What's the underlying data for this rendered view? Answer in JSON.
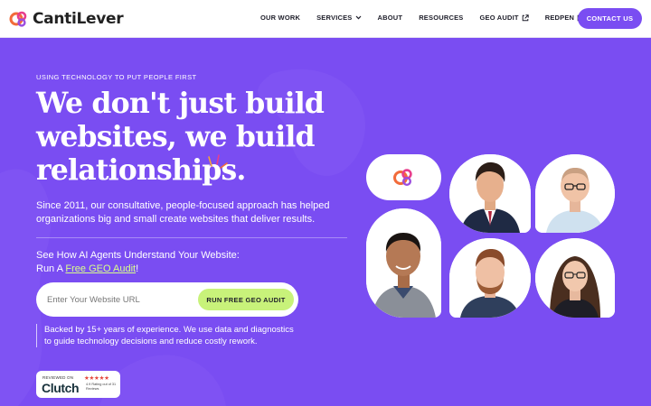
{
  "header": {
    "brand": "CantiLever",
    "nav": [
      {
        "label": "OUR WORK",
        "icon": null
      },
      {
        "label": "SERVICES",
        "icon": "chevron-down-icon"
      },
      {
        "label": "ABOUT",
        "icon": null
      },
      {
        "label": "RESOURCES",
        "icon": null
      },
      {
        "label": "GEO AUDIT",
        "icon": "external-link-icon"
      },
      {
        "label": "REDPEN",
        "icon": "external-link-icon"
      }
    ],
    "contact_label": "CONTACT US"
  },
  "hero": {
    "eyebrow": "USING TECHNOLOGY TO PUT PEOPLE FIRST",
    "headline_lines": [
      "We don't just build",
      "websites, we build",
      "relationships."
    ],
    "subtext": "Since 2011, our consultative, people-focused approach has helped organizations big and small create websites that deliver results.",
    "geo_cta_line1": "See How AI Agents Understand Your Website:",
    "geo_cta_prefix": "Run A ",
    "geo_cta_link": "Free GEO Audit",
    "geo_cta_suffix": "!",
    "url_placeholder": "Enter Your Website URL",
    "url_value": "",
    "run_button": "RUN FREE GEO AUDIT",
    "backed_text": "Backed by 15+ years of experience. We use data and diagnostics to guide technology decisions and reduce costly rework."
  },
  "clutch": {
    "reviewed_on": "REVIEWED ON",
    "name": "Clutch",
    "stars": "★★★★★",
    "rating_text": "4.9 Rating out of 31 Reviews"
  },
  "colors": {
    "brand_purple": "#7a4df2",
    "accent_lime": "#c8f27a",
    "link_lime": "#d8ff8a",
    "logo_orange": "#f26b3a",
    "logo_pink": "#e83e8c"
  }
}
